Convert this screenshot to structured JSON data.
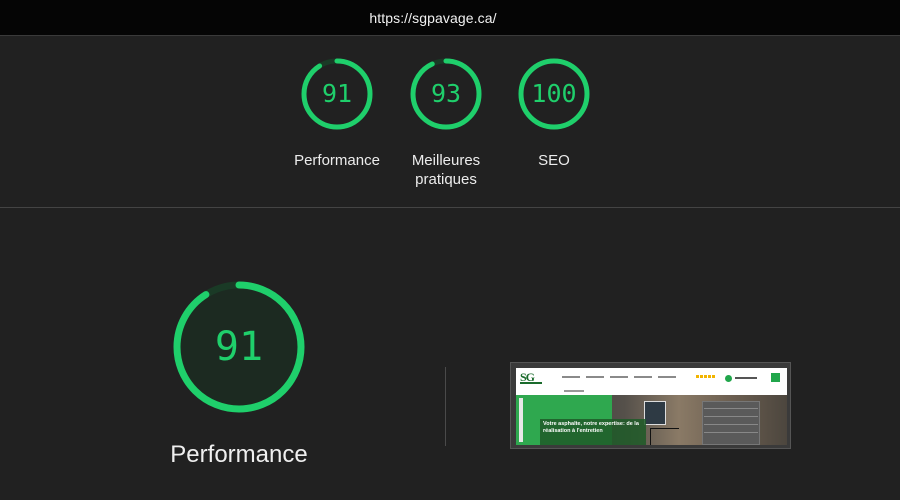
{
  "url_bar": {
    "url": "https://sgpavage.ca/"
  },
  "summary": {
    "gauges": [
      {
        "score": "91",
        "label": "Performance",
        "value": 91
      },
      {
        "score": "93",
        "label": "Meilleures pratiques",
        "value": 93
      },
      {
        "score": "100",
        "label": "SEO",
        "value": 100
      }
    ]
  },
  "detail": {
    "score": "91",
    "value": 91,
    "label": "Performance",
    "thumbnail": {
      "logo": "SG",
      "hero_text": "Votre asphalte, notre expertise: de la réalisation à l'entretien"
    }
  },
  "colors": {
    "pass_green": "#1fcf6b",
    "gauge_track": "#1a3a26",
    "background": "#212121",
    "url_bar_bg": "#050505"
  }
}
